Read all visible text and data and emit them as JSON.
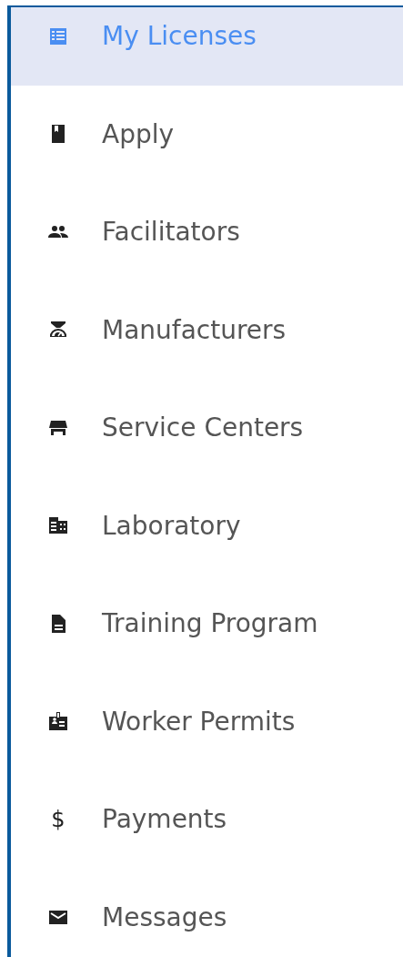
{
  "sidebar": {
    "items": [
      {
        "label": "My Licenses",
        "selected": true
      },
      {
        "label": "Apply",
        "selected": false
      },
      {
        "label": "Facilitators",
        "selected": false
      },
      {
        "label": "Manufacturers",
        "selected": false
      },
      {
        "label": "Service Centers",
        "selected": false
      },
      {
        "label": "Laboratory",
        "selected": false
      },
      {
        "label": "Training Program",
        "selected": false
      },
      {
        "label": "Worker Permits",
        "selected": false
      },
      {
        "label": "Payments",
        "selected": false,
        "glyph": "$"
      },
      {
        "label": "Messages",
        "selected": false
      }
    ]
  }
}
